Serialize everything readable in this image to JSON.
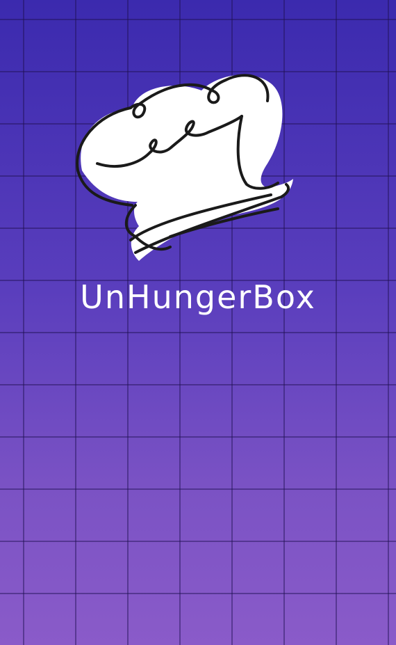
{
  "app": {
    "brand_name": "UnHungerBox",
    "logo_icon": "chef-hat-icon"
  },
  "colors": {
    "background_top": "#3b2aae",
    "background_bottom": "#8a5bc9",
    "grid_line": "#1e0f50",
    "logo_fill": "#ffffff",
    "logo_stroke": "#1a1a1a",
    "text": "#ffffff"
  }
}
